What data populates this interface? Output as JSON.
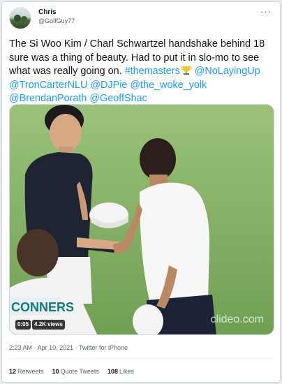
{
  "author": {
    "name": "Chris",
    "handle": "@GolfGuy77"
  },
  "more_icon": "more-horizontal-icon",
  "tweet": {
    "text_plain": "The Si Woo Kim / Charl Schwartzel handshake behind 18 sure was a thing of beauty. Had to put it in slo-mo to see what was really going on.",
    "hashtag": "#themasters",
    "emoji": "trophy-icon",
    "mentions": [
      "@NoLayingUp",
      "@TronCarterNLU",
      "@DJPie",
      "@the_woke_yolk",
      "@BrendanPorath",
      "@GeoffShac"
    ]
  },
  "media": {
    "time": "0:05",
    "views": "4.2K views",
    "watermark": "clideo.com",
    "sign_text": "CONNERS"
  },
  "meta": {
    "time": "2:23 AM",
    "separator": "·",
    "date": "Apr 10, 2021",
    "source": "Twitter for iPhone"
  },
  "stats": {
    "retweets": {
      "count": "12",
      "label": "Retweets"
    },
    "quotes": {
      "count": "10",
      "label": "Quote Tweets"
    },
    "likes": {
      "count": "108",
      "label": "Likes"
    }
  },
  "colors": {
    "link": "#1d9bf0",
    "text": "#0f1419",
    "muted": "#536471"
  }
}
